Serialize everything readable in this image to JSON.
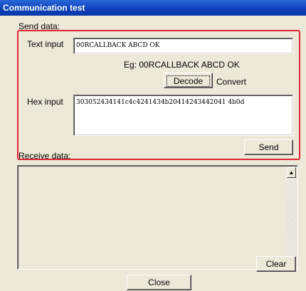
{
  "window": {
    "title": "Communication test"
  },
  "send": {
    "section_label": "Send data:",
    "text_input_label": "Text input",
    "text_input_value": "00RCALLBACK ABCD OK",
    "example": "Eg: 00RCALLBACK ABCD OK",
    "decode_label": "Decode",
    "convert_label": "Convert",
    "hex_input_label": "Hex input",
    "hex_input_value": "303052434141c4c4241434b20414243442041 4b0d",
    "send_label": "Send"
  },
  "receive": {
    "section_label": "Receive data:",
    "value": "",
    "clear_label": "Clear",
    "scroll_up_icon": "triangle-up",
    "scroll_down_icon": "triangle-down"
  },
  "footer": {
    "close_label": "Close"
  },
  "colors": {
    "highlight": "#e0242f",
    "titlebar": "#0a3fb8",
    "background": "#ece9d8"
  }
}
